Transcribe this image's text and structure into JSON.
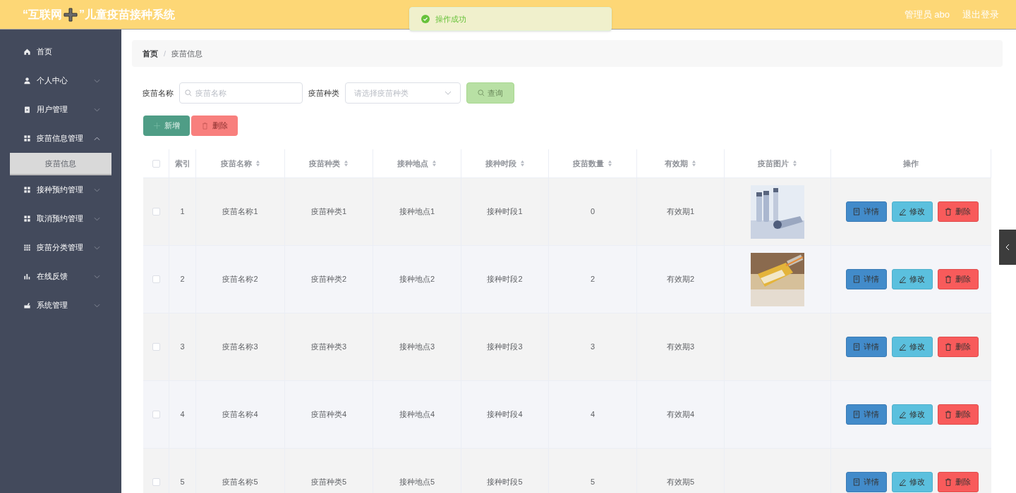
{
  "header": {
    "title_before": "“互联网",
    "title_after": "”儿童疫苗接种系统",
    "user": "管理员 abo",
    "logout": "退出登录"
  },
  "toast": {
    "kind": "success",
    "text": "操作成功"
  },
  "sidebar": {
    "items": [
      {
        "label": "首页",
        "kind": "link"
      },
      {
        "label": "个人中心",
        "kind": "menu",
        "expanded": false
      },
      {
        "label": "用户管理",
        "kind": "menu",
        "expanded": false
      },
      {
        "label": "疫苗信息管理",
        "kind": "menu",
        "expanded": true,
        "children": [
          {
            "label": "疫苗信息",
            "selected": true
          }
        ]
      },
      {
        "label": "接种预约管理",
        "kind": "menu",
        "expanded": false
      },
      {
        "label": "取消预约管理",
        "kind": "menu",
        "expanded": false
      },
      {
        "label": "疫苗分类管理",
        "kind": "menu",
        "expanded": false
      },
      {
        "label": "在线反馈",
        "kind": "menu",
        "expanded": false
      },
      {
        "label": "系统管理",
        "kind": "menu",
        "expanded": false
      }
    ]
  },
  "breadcrumb": {
    "separator": "/",
    "items": [
      "首页",
      "疫苗信息"
    ]
  },
  "search": {
    "fields": [
      {
        "kind": "input",
        "label": "疫苗名称",
        "placeholder": "疫苗名称"
      },
      {
        "kind": "select",
        "label": "疫苗种类",
        "placeholder": "请选择疫苗种类"
      }
    ],
    "button": "查询"
  },
  "toolbar": [
    {
      "kind": "add",
      "label": "新增"
    },
    {
      "kind": "delete",
      "label": "删除"
    }
  ],
  "table": {
    "select_all": {
      "checked": false
    },
    "columns": [
      {
        "label": "索引",
        "sortable": false
      },
      {
        "label": "疫苗名称",
        "sortable": true
      },
      {
        "label": "疫苗种类",
        "sortable": true
      },
      {
        "label": "接种地点",
        "sortable": true
      },
      {
        "label": "接种时段",
        "sortable": true
      },
      {
        "label": "疫苗数量",
        "sortable": true
      },
      {
        "label": "有效期",
        "sortable": true
      },
      {
        "label": "疫苗图片",
        "sortable": true
      },
      {
        "label": "操作",
        "sortable": false
      }
    ],
    "rows": [
      {
        "checked": false,
        "cells": [
          "1",
          "疫苗名称1",
          "疫苗种类1",
          "接种地点1",
          "接种时段1",
          "0",
          "有效期1"
        ],
        "actions": [
          {
            "kind": "detail",
            "label": "详情"
          },
          {
            "kind": "edit",
            "label": "修改"
          },
          {
            "kind": "delete",
            "label": "删除"
          }
        ]
      },
      {
        "checked": false,
        "cells": [
          "2",
          "疫苗名称2",
          "疫苗种类2",
          "接种地点2",
          "接种时段2",
          "2",
          "有效期2"
        ],
        "actions": [
          {
            "kind": "detail",
            "label": "详情"
          },
          {
            "kind": "edit",
            "label": "修改"
          },
          {
            "kind": "delete",
            "label": "删除"
          }
        ]
      },
      {
        "checked": false,
        "cells": [
          "3",
          "疫苗名称3",
          "疫苗种类3",
          "接种地点3",
          "接种时段3",
          "3",
          "有效期3"
        ],
        "actions": [
          {
            "kind": "detail",
            "label": "详情"
          },
          {
            "kind": "edit",
            "label": "修改"
          },
          {
            "kind": "delete",
            "label": "删除"
          }
        ]
      },
      {
        "checked": false,
        "cells": [
          "4",
          "疫苗名称4",
          "疫苗种类4",
          "接种地点4",
          "接种时段4",
          "4",
          "有效期4"
        ],
        "actions": [
          {
            "kind": "detail",
            "label": "详情"
          },
          {
            "kind": "edit",
            "label": "修改"
          },
          {
            "kind": "delete",
            "label": "删除"
          }
        ]
      },
      {
        "checked": false,
        "cells": [
          "5",
          "疫苗名称5",
          "疫苗种类5",
          "接种地点5",
          "接种时段5",
          "5",
          "有效期5"
        ],
        "actions": [
          {
            "kind": "detail",
            "label": "详情"
          },
          {
            "kind": "edit",
            "label": "修改"
          },
          {
            "kind": "delete",
            "label": "删除"
          }
        ]
      }
    ]
  }
}
